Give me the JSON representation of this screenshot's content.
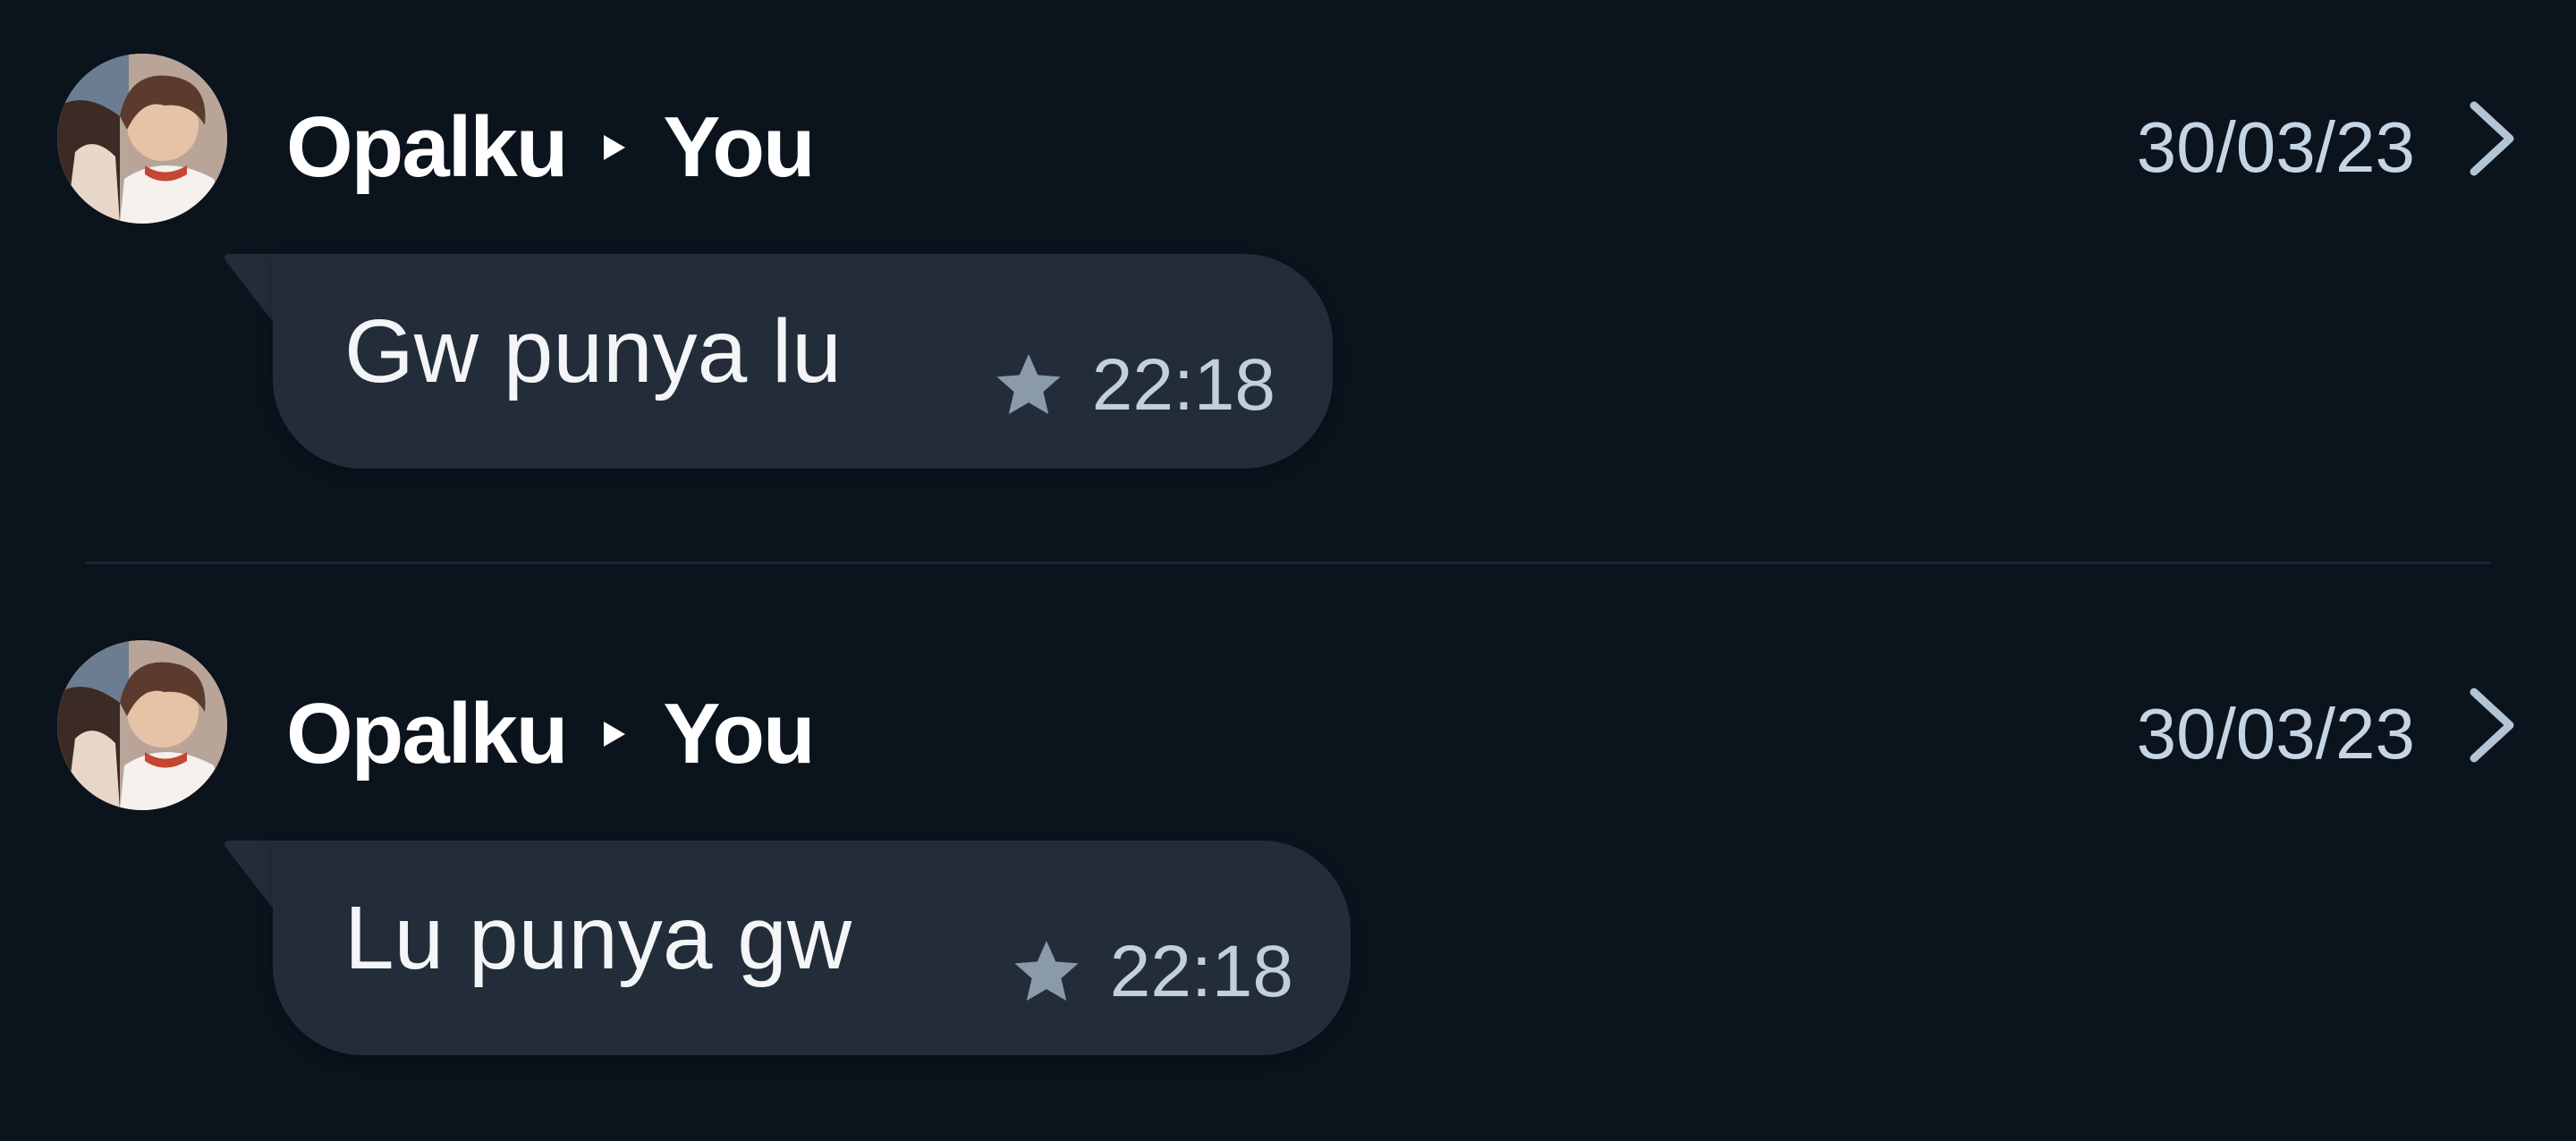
{
  "conversations": [
    {
      "sender": "Opalku",
      "recipient": "You",
      "date": "30/03/23",
      "message": "Gw punya lu",
      "time": "22:18",
      "starred": true,
      "star_icon": "star-icon",
      "open_icon": "chevron-right-icon"
    },
    {
      "sender": "Opalku",
      "recipient": "You",
      "date": "30/03/23",
      "message": "Lu punya gw",
      "time": "22:18",
      "starred": true,
      "star_icon": "star-icon",
      "open_icon": "chevron-right-icon"
    }
  ],
  "colors": {
    "background": "#0b131d",
    "bubble": "#232d39",
    "star": "#8a9aaa",
    "meta_text": "#c2d0dd"
  }
}
